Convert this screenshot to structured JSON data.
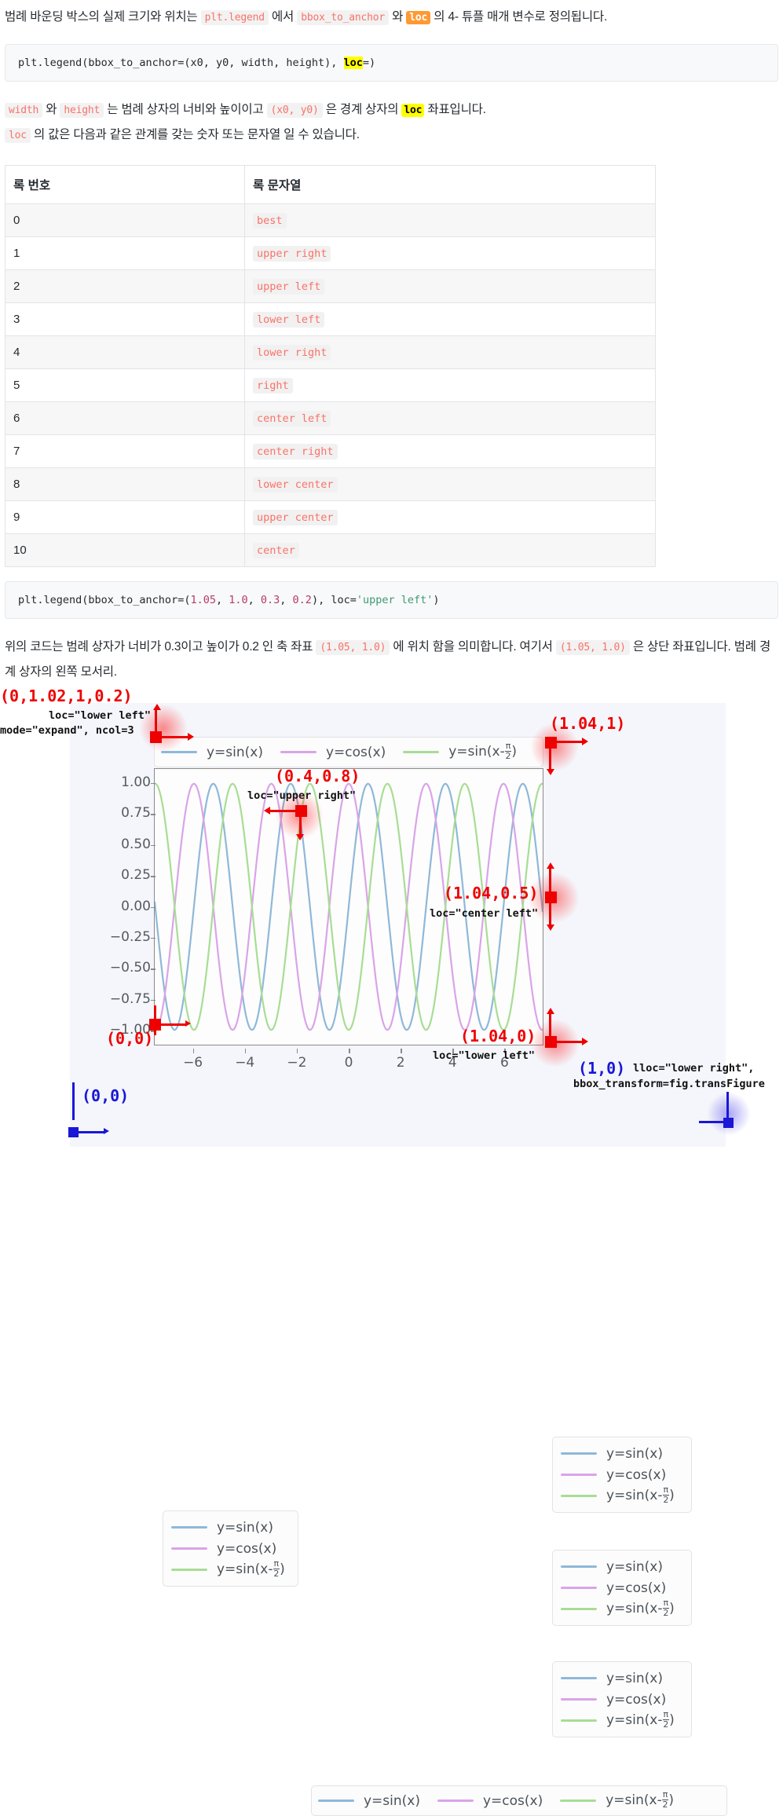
{
  "paragraphs": {
    "p1_a": "범례 바운딩 박스의 실제 크기와 위치는 ",
    "p1_code1": "plt.legend",
    "p1_b": " 에서 ",
    "p1_code2": "bbox_to_anchor",
    "p1_c": " 와 ",
    "p1_code3": "loc",
    "p1_d": " 의 4- 튜플 매개 변수로 정의됩니다.",
    "p2_code1": "width",
    "p2_a": " 와 ",
    "p2_code2": "height",
    "p2_b": " 는 범례 상자의 너비와 높이이고 ",
    "p2_code3": "(x0, y0)",
    "p2_c": " 은 경계 상자의 ",
    "p2_code4": "loc",
    "p2_d": " 좌표입니다.",
    "p3_code1": "loc",
    "p3_a": " 의 값은 다음과 같은 관계를 갖는 숫자 또는 문자열 일 수 있습니다.",
    "p4_a": "위의 코드는 범례 상자가 너비가 0.3이고 높이가 0.2 인 축 좌표 ",
    "p4_code1": "(1.05, 1.0)",
    "p4_b": " 에 위치 함을 의미합니다. 여기서 ",
    "p4_code2": "(1.05, 1.0)",
    "p4_c": " 은 상단 좌표입니다. 범례 경계 상자의 왼쪽 모서리."
  },
  "code_blocks": {
    "block1": {
      "pre": "plt.legend(bbox_to_anchor=(x0, y0, width, height), ",
      "hl": "loc",
      "post": "=)"
    },
    "block2": {
      "a": "plt.legend(bbox_to_anchor=(",
      "n1": "1.05",
      "c1": ", ",
      "n2": "1.0",
      "c2": ", ",
      "n3": "0.3",
      "c3": ", ",
      "n4": "0.2",
      "c4": "), loc=",
      "s1": "'upper left'",
      "end": ")"
    }
  },
  "table": {
    "headers": [
      "록 번호",
      "록 문자열"
    ],
    "rows": [
      {
        "num": "0",
        "str": "best"
      },
      {
        "num": "1",
        "str": "upper right"
      },
      {
        "num": "2",
        "str": "upper left"
      },
      {
        "num": "3",
        "str": "lower left"
      },
      {
        "num": "4",
        "str": "lower right"
      },
      {
        "num": "5",
        "str": "right"
      },
      {
        "num": "6",
        "str": "center left"
      },
      {
        "num": "7",
        "str": "center right"
      },
      {
        "num": "8",
        "str": "lower center"
      },
      {
        "num": "9",
        "str": "upper center"
      },
      {
        "num": "10",
        "str": "center"
      }
    ]
  },
  "figure": {
    "series_labels": {
      "sin": "y=sin(x)",
      "cos": "y=cos(x)",
      "shift_pre": "y=sin(x-",
      "shift_num": "π",
      "shift_den": "2",
      "shift_post": ")"
    },
    "colors": {
      "sin": "#8fb8d8",
      "cos": "#d9a4e8",
      "shift": "#a8dd94",
      "anchor_red": "#ee0000",
      "anchor_blue": "#1a17d6",
      "fig_bg": "#f4f6fb",
      "axes_bg": "#fdfdfd"
    },
    "annotations": [
      {
        "id": "a1",
        "coord": "(0,1.02,1,0.2)",
        "line1": "loc=\"lower left\"",
        "line2": "mode=\"expand\", ncol=3",
        "color": "#ee0000"
      },
      {
        "id": "a2",
        "coord": "(1.04,1)",
        "line1": "",
        "line2": "",
        "color": "#ee0000"
      },
      {
        "id": "a3",
        "coord": "(0.4,0.8)",
        "line1": "loc=\"upper right\"",
        "line2": "",
        "color": "#ee0000"
      },
      {
        "id": "a4",
        "coord": "(1.04,0.5)",
        "line1": "loc=\"center left\"",
        "line2": "",
        "color": "#ee0000"
      },
      {
        "id": "a5",
        "coord": "(1.04,0)",
        "line1": "loc=\"lower left\"",
        "line2": "",
        "color": "#ee0000"
      },
      {
        "id": "a6",
        "coord": "(0,0)",
        "line1": "",
        "line2": "",
        "color": "#ee0000"
      },
      {
        "id": "a7",
        "coord": "(1,0)",
        "line1": "lloc=\"lower right\",",
        "line2": "bbox_transform=fig.transFigure",
        "color": "#1a17d6"
      },
      {
        "id": "a8",
        "coord": "(0,0)",
        "line1": "",
        "line2": "",
        "color": "#1a17d6"
      }
    ]
  },
  "chart_data": {
    "type": "line",
    "title": "",
    "xlabel": "",
    "ylabel": "",
    "xlim": [
      -7.5,
      7.5
    ],
    "ylim": [
      -1.12,
      1.12
    ],
    "xticks": [
      -6,
      -4,
      -2,
      0,
      2,
      4,
      6
    ],
    "yticks": [
      -1.0,
      -0.75,
      -0.5,
      -0.25,
      0.0,
      0.25,
      0.5,
      0.75,
      1.0
    ],
    "ytick_labels": [
      "-1.00",
      "-0.75",
      "-0.50",
      "-0.25",
      "0.00",
      "0.25",
      "0.50",
      "0.75",
      "1.00"
    ],
    "xtick_labels": [
      "-6",
      "-4",
      "-2",
      "0",
      "2",
      "4",
      "6"
    ],
    "grid": false,
    "legend_position": "multiple",
    "series": [
      {
        "name": "y=sin(x)",
        "color": "#8fb8d8",
        "fn": "sin",
        "amplitude": 1.0,
        "freq": 2.1,
        "phase": 0.0
      },
      {
        "name": "y=cos(x)",
        "color": "#d9a4e8",
        "fn": "cos",
        "amplitude": 1.0,
        "freq": 2.1,
        "phase": 0.0
      },
      {
        "name": "y=sin(x-pi/2)",
        "color": "#a8dd94",
        "fn": "shift",
        "amplitude": 1.0,
        "freq": 2.1,
        "phase": -1.5707963
      }
    ]
  }
}
